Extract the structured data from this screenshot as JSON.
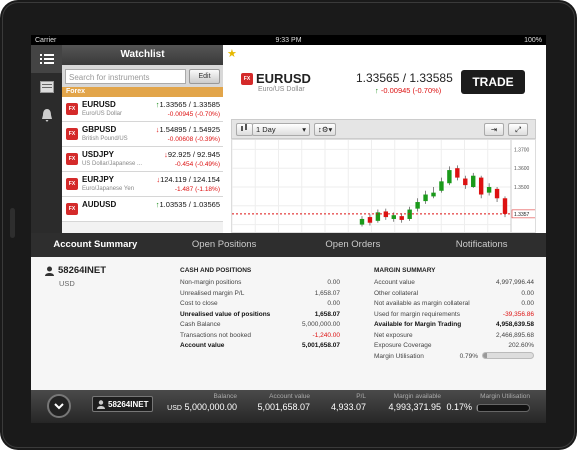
{
  "status": {
    "carrier": "Carrier",
    "time": "9:33 PM",
    "battery": "100%"
  },
  "nav": {
    "icons": [
      "list-icon",
      "document-icon",
      "bell-icon"
    ]
  },
  "watchlist": {
    "title": "Watchlist",
    "search_placeholder": "Search for instruments",
    "edit_label": "Edit",
    "section": "Forex",
    "items": [
      {
        "symbol": "EURUSD",
        "name": "Euro/US Dollar",
        "prices": "1.33565 / 1.33585",
        "dir": "up",
        "change": "-0.00945  (-0.70%)"
      },
      {
        "symbol": "GBPUSD",
        "name": "British Pound/US",
        "prices": "1.54895 / 1.54925",
        "dir": "dn",
        "change": "-0.00608  (-0.39%)"
      },
      {
        "symbol": "USDJPY",
        "name": "US Dollar/Japanese ...",
        "prices": "92.925 / 92.945",
        "dir": "dn",
        "change": "-0.454  (-0.49%)"
      },
      {
        "symbol": "EURJPY",
        "name": "Euro/Japanese Yen",
        "prices": "124.119 / 124.154",
        "dir": "dn",
        "change": "-1.487  (-1.18%)"
      },
      {
        "symbol": "AUDUSD",
        "name": "",
        "prices": "1.03535 / 1.03565",
        "dir": "up",
        "change": ""
      }
    ]
  },
  "instrument": {
    "symbol": "EURUSD",
    "name": "Euro/US Dollar",
    "prices": "1.33565 / 1.33585",
    "change": "-0.00945  (-0.70%)",
    "trade_label": "TRADE",
    "timeframe": "1 Day"
  },
  "chart_data": {
    "type": "candlestick",
    "y_ticks": [
      "1.3700",
      "1.3600",
      "1.3500"
    ],
    "current_price_label": "1.3357",
    "ylim": [
      1.325,
      1.375
    ],
    "candles": [
      {
        "o": 1.33,
        "c": 1.333,
        "h": 1.3345,
        "l": 1.329
      },
      {
        "o": 1.334,
        "c": 1.331,
        "h": 1.3355,
        "l": 1.3295
      },
      {
        "o": 1.332,
        "c": 1.3365,
        "h": 1.338,
        "l": 1.331
      },
      {
        "o": 1.337,
        "c": 1.334,
        "h": 1.3385,
        "l": 1.3325
      },
      {
        "o": 1.333,
        "c": 1.335,
        "h": 1.3365,
        "l": 1.3315
      },
      {
        "o": 1.3345,
        "c": 1.3325,
        "h": 1.336,
        "l": 1.331
      },
      {
        "o": 1.333,
        "c": 1.338,
        "h": 1.3395,
        "l": 1.332
      },
      {
        "o": 1.3385,
        "c": 1.342,
        "h": 1.344,
        "l": 1.337
      },
      {
        "o": 1.3425,
        "c": 1.346,
        "h": 1.348,
        "l": 1.341
      },
      {
        "o": 1.345,
        "c": 1.347,
        "h": 1.35,
        "l": 1.344
      },
      {
        "o": 1.348,
        "c": 1.353,
        "h": 1.355,
        "l": 1.347
      },
      {
        "o": 1.352,
        "c": 1.359,
        "h": 1.361,
        "l": 1.351
      },
      {
        "o": 1.36,
        "c": 1.355,
        "h": 1.3615,
        "l": 1.3535
      },
      {
        "o": 1.3545,
        "c": 1.351,
        "h": 1.356,
        "l": 1.349
      },
      {
        "o": 1.35,
        "c": 1.356,
        "h": 1.3575,
        "l": 1.3495
      },
      {
        "o": 1.355,
        "c": 1.346,
        "h": 1.356,
        "l": 1.344
      },
      {
        "o": 1.347,
        "c": 1.35,
        "h": 1.352,
        "l": 1.3455
      },
      {
        "o": 1.349,
        "c": 1.344,
        "h": 1.35,
        "l": 1.342
      },
      {
        "o": 1.344,
        "c": 1.3357,
        "h": 1.345,
        "l": 1.334
      }
    ]
  },
  "tabs": [
    "Account Summary",
    "Open Positions",
    "Open Orders",
    "Notifications"
  ],
  "account": {
    "id": "58264INET",
    "currency": "USD",
    "cash_title": "CASH AND POSITIONS",
    "cash": [
      {
        "k": "Non-margin positions",
        "v": "0.00",
        "bold": false,
        "neg": false
      },
      {
        "k": "Unrealised margin P/L",
        "v": "1,658.07",
        "bold": false,
        "neg": false
      },
      {
        "k": "Cost to close",
        "v": "0.00",
        "bold": false,
        "neg": false
      },
      {
        "k": "Unrealised value of positions",
        "v": "1,658.07",
        "bold": true,
        "neg": false
      },
      {
        "k": "Cash Balance",
        "v": "5,000,000.00",
        "bold": false,
        "neg": false
      },
      {
        "k": "Transactions not booked",
        "v": "-1,240.00",
        "bold": false,
        "neg": true
      },
      {
        "k": "Account value",
        "v": "5,001,658.07",
        "bold": true,
        "neg": false
      }
    ],
    "margin_title": "MARGIN SUMMARY",
    "margin": [
      {
        "k": "Account value",
        "v": "4,997,996.44",
        "bold": false,
        "neg": false
      },
      {
        "k": "Other collateral",
        "v": "0.00",
        "bold": false,
        "neg": false
      },
      {
        "k": "Not available as margin collateral",
        "v": "0.00",
        "bold": false,
        "neg": false
      },
      {
        "k": "Used for margin requirements",
        "v": "-39,356.86",
        "bold": false,
        "neg": true
      },
      {
        "k": "Available for Margin Trading",
        "v": "4,958,639.58",
        "bold": true,
        "neg": false
      },
      {
        "k": "Net exposure",
        "v": "2,466,895.68",
        "bold": false,
        "neg": false
      },
      {
        "k": "Exposure Coverage",
        "v": "202.60%",
        "bold": false,
        "neg": false
      }
    ],
    "margin_util_label": "Margin Utilisation",
    "margin_util_value": "0.79%",
    "margin_util_fraction": 0.0079
  },
  "footer": {
    "account": "58264INET",
    "stats": [
      {
        "label": "Balance",
        "prefix": "USD",
        "value": "5,000,000.00"
      },
      {
        "label": "Account value",
        "prefix": "",
        "value": "5,001,658.07"
      },
      {
        "label": "P/L",
        "prefix": "",
        "value": "4,933.07"
      },
      {
        "label": "Margin available",
        "prefix": "",
        "value": "4,993,371.95"
      },
      {
        "label": "Margin Utilisation",
        "prefix": "",
        "value": "0.17%"
      }
    ],
    "util_fraction": 0.0017
  },
  "colors": {
    "accent": "#d42a2a",
    "up": "#1a8d1a",
    "down": "#d11111",
    "section": "#e2a54a"
  }
}
